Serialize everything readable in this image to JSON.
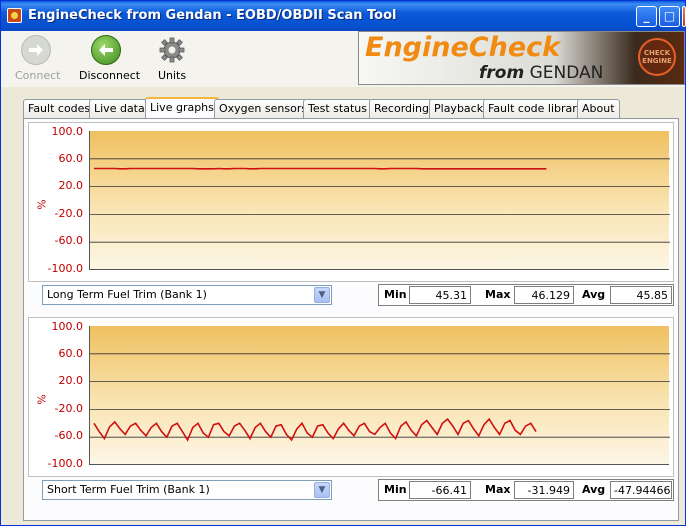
{
  "window": {
    "title": "EngineCheck from Gendan - EOBD/OBDII Scan Tool",
    "minimize": "_",
    "maximize": "□",
    "close": "✕"
  },
  "toolbar": {
    "connect": "Connect",
    "disconnect": "Disconnect",
    "units": "Units"
  },
  "logo": {
    "line1": "EngineCheck",
    "line2_prefix": "from",
    "line2_brand": "GENDAN",
    "badge": "CHECK ENGINE"
  },
  "tabs": [
    "Fault codes",
    "Live data",
    "Live graphs",
    "Oxygen sensors",
    "Test status",
    "Recording",
    "Playback",
    "Fault code library",
    "About"
  ],
  "active_tab": "Live graphs",
  "graphs": [
    {
      "y_unit": "%",
      "y_ticks": [
        "100.0",
        "60.0",
        "20.0",
        "-20.0",
        "-60.0",
        "-100.0"
      ],
      "parameter": "Long Term Fuel Trim (Bank 1)",
      "min_label": "Min",
      "min": "45.31",
      "max_label": "Max",
      "max": "46.129",
      "avg_label": "Avg",
      "avg": "45.85"
    },
    {
      "y_unit": "%",
      "y_ticks": [
        "100.0",
        "60.0",
        "20.0",
        "-20.0",
        "-60.0",
        "-100.0"
      ],
      "parameter": "Short Term Fuel Trim (Bank 1)",
      "min_label": "Min",
      "min": "-66.41",
      "max_label": "Max",
      "max": "-31.949",
      "avg_label": "Avg",
      "avg": "-47.94466"
    }
  ],
  "chart_data": [
    {
      "type": "line",
      "ylabel": "%",
      "ylim": [
        -100,
        100
      ],
      "series": [
        {
          "name": "Long Term Fuel Trim (Bank 1)",
          "color": "#d01010",
          "values": [
            46.1,
            46.1,
            46.1,
            46.1,
            46.1,
            45.6,
            45.6,
            46.1,
            46.1,
            46.1,
            46.1,
            46.1,
            46.1,
            46.1,
            46.1,
            46.1,
            46.1,
            46.1,
            46.1,
            46.1,
            45.6,
            45.6,
            45.6,
            45.6,
            46.1,
            45.6,
            45.6,
            46.1,
            46.1,
            46.1,
            45.6,
            45.6,
            46.1,
            46.1,
            46.1,
            46.1,
            46.1,
            46.1,
            46.1,
            46.1,
            46.1,
            46.1,
            46.1,
            46.1,
            46.1,
            46.1,
            46.1,
            46.1,
            46.1,
            46.1,
            46.1,
            46.1,
            46.1,
            46.1,
            46.1,
            45.6,
            45.6,
            46.1,
            46.1,
            46.1,
            46.1,
            46.1,
            46.1,
            45.6,
            45.6,
            45.6,
            45.6,
            45.6,
            45.6,
            45.6,
            45.6,
            45.6,
            45.6,
            45.6,
            45.6,
            45.6,
            45.6,
            45.6,
            45.6,
            45.6,
            45.6,
            45.6,
            45.6,
            45.6,
            45.6,
            45.6,
            45.6,
            45.6
          ]
        }
      ]
    },
    {
      "type": "line",
      "ylabel": "%",
      "ylim": [
        -100,
        100
      ],
      "series": [
        {
          "name": "Short Term Fuel Trim (Bank 1)",
          "color": "#d01010",
          "values": [
            -40,
            -52,
            -62,
            -45,
            -38,
            -48,
            -56,
            -44,
            -40,
            -50,
            -58,
            -46,
            -40,
            -52,
            -60,
            -44,
            -40,
            -52,
            -64,
            -46,
            -40,
            -54,
            -60,
            -42,
            -40,
            -52,
            -58,
            -44,
            -40,
            -50,
            -62,
            -46,
            -40,
            -52,
            -60,
            -44,
            -42,
            -56,
            -64,
            -48,
            -40,
            -54,
            -60,
            -44,
            -42,
            -54,
            -62,
            -48,
            -40,
            -50,
            -58,
            -44,
            -40,
            -52,
            -56,
            -46,
            -40,
            -54,
            -62,
            -44,
            -38,
            -50,
            -58,
            -42,
            -36,
            -46,
            -56,
            -40,
            -34,
            -44,
            -56,
            -40,
            -36,
            -48,
            -58,
            -42,
            -34,
            -46,
            -56,
            -40,
            -36,
            -50,
            -56,
            -44,
            -40,
            -52
          ]
        }
      ]
    }
  ],
  "colors": {
    "titlebar": "#0650d0",
    "accent_tab": "#f4b63c",
    "plot_top": "#f0c060",
    "plot_bottom": "#fdf6e6",
    "trace": "#d01010",
    "tick_text": "#c00000"
  }
}
